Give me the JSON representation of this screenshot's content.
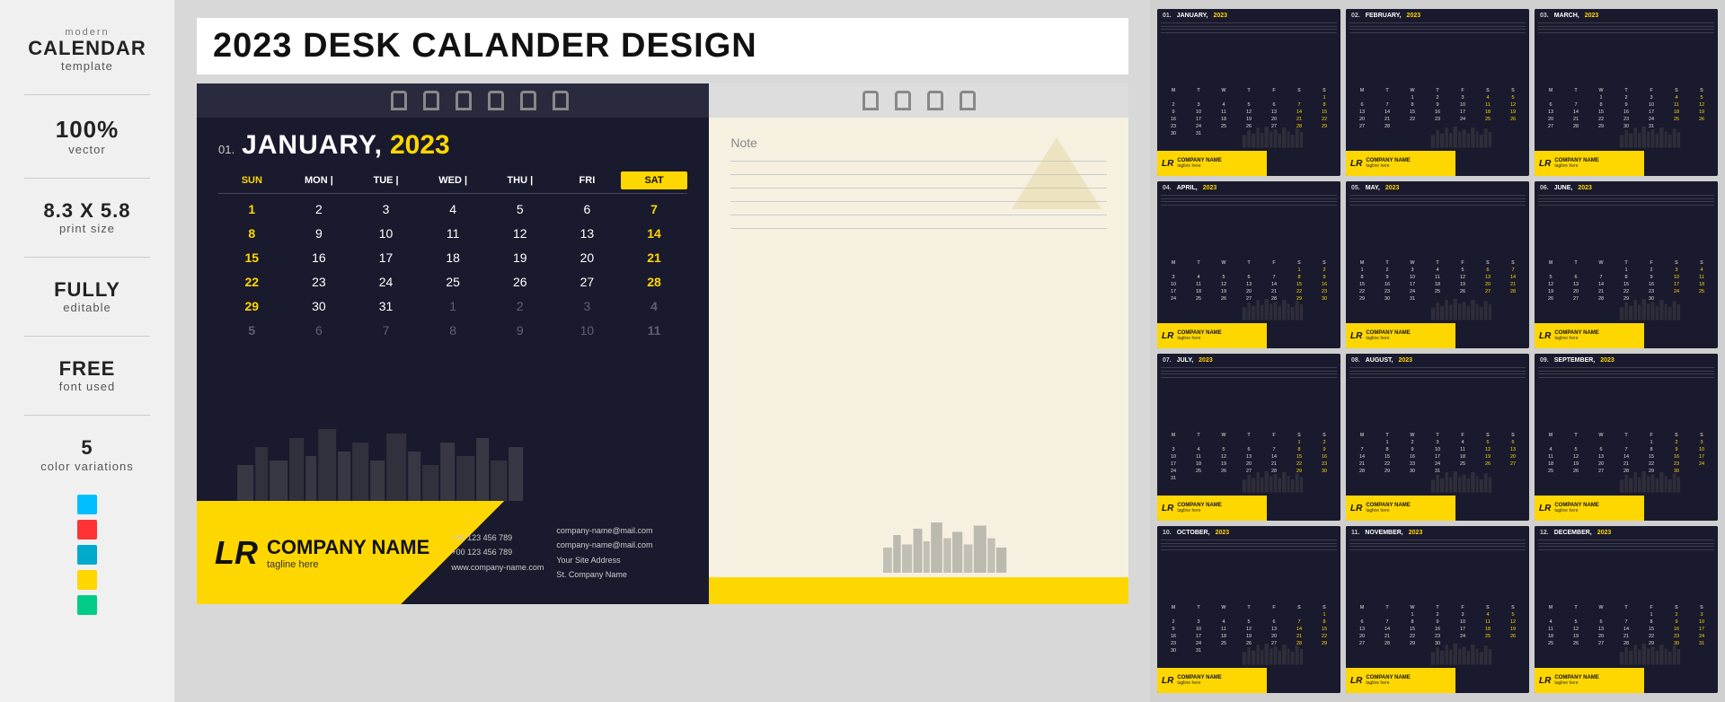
{
  "sidebar": {
    "pre_label": "modern",
    "main_label": "CALENDAR",
    "sub_label": "template",
    "vector_pre": "100%",
    "vector_label": "vector",
    "print_size_pre": "8.3 x 5.8",
    "print_size_label": "print size",
    "editable_pre": "FULLY",
    "editable_label": "editable",
    "font_pre": "FREE",
    "font_label": "font used",
    "colors_pre": "5",
    "colors_label": "color variations",
    "swatches": [
      "#00BFFF",
      "#FF3333",
      "#00AACC",
      "#FFD700",
      "#00CC88"
    ]
  },
  "main": {
    "title": "2023 DESK CALANDER DESIGN",
    "calendar": {
      "month_num": "01.",
      "month_name": "JANUARY,",
      "year": "2023",
      "days_header": [
        "SUN",
        "MON",
        "TUE",
        "WED",
        "THU",
        "FRI",
        "SAT"
      ],
      "days": [
        "1",
        "2",
        "3",
        "4",
        "5",
        "6",
        "7",
        "8",
        "9",
        "10",
        "11",
        "12",
        "13",
        "14",
        "15",
        "16",
        "17",
        "18",
        "19",
        "20",
        "21",
        "22",
        "23",
        "24",
        "25",
        "26",
        "27",
        "28",
        "29",
        "30",
        "31",
        "1",
        "2",
        "3",
        "4",
        "5",
        "6",
        "7",
        "8",
        "9",
        "10",
        "11"
      ],
      "note_label": "Note"
    },
    "company": {
      "logo": "LR",
      "name": "COMPANY NAME",
      "tagline": "tagline here",
      "phone1": "+00 123 456 789",
      "phone2": "+00 123 456 789",
      "website": "www.company-name.com",
      "email1": "company-name@mail.com",
      "email2": "company-name@mail.com",
      "site_label": "Your Site Address",
      "address": "St. Company Name"
    }
  },
  "mini_calendars": [
    {
      "num": "01",
      "month": "JANUARY, 2023",
      "days": [
        "1",
        "2",
        "3",
        "4",
        "5",
        "6",
        "7",
        "8",
        "9",
        "10",
        "11",
        "12",
        "13",
        "14",
        "15",
        "16",
        "17",
        "18",
        "19",
        "20",
        "21",
        "22",
        "23",
        "24",
        "25",
        "26",
        "27",
        "28",
        "29",
        "30",
        "31"
      ]
    },
    {
      "num": "02",
      "month": "FEBRUARY, 2023",
      "days": [
        "",
        "",
        "",
        "1",
        "2",
        "3",
        "4",
        "5",
        "6",
        "7",
        "8",
        "9",
        "10",
        "11",
        "12",
        "13",
        "14",
        "15",
        "16",
        "17",
        "18",
        "19",
        "20",
        "21",
        "22",
        "23",
        "24",
        "25",
        "26",
        "27",
        "28"
      ]
    },
    {
      "num": "03",
      "month": "MARCH, 2023",
      "days": [
        "",
        "",
        "",
        "1",
        "2",
        "3",
        "4",
        "5",
        "6",
        "7",
        "8",
        "9",
        "10",
        "11",
        "12",
        "13",
        "14",
        "15",
        "16",
        "17",
        "18",
        "19",
        "20",
        "21",
        "22",
        "23",
        "24",
        "25",
        "26",
        "27",
        "28",
        "29",
        "30",
        "31"
      ]
    },
    {
      "num": "04",
      "month": "APRIL, 2023",
      "days": [
        "",
        "",
        "",
        "",
        "",
        "",
        "1",
        "2",
        "3",
        "4",
        "5",
        "6",
        "7",
        "8",
        "9",
        "10",
        "11",
        "12",
        "13",
        "14",
        "15",
        "16",
        "17",
        "18",
        "19",
        "20",
        "21",
        "22",
        "23",
        "24",
        "25",
        "26",
        "27",
        "28",
        "29",
        "30"
      ]
    },
    {
      "num": "05",
      "month": "MAY, 2023",
      "days": [
        "1",
        "2",
        "3",
        "4",
        "5",
        "6",
        "7",
        "8",
        "9",
        "10",
        "11",
        "12",
        "13",
        "14",
        "15",
        "16",
        "17",
        "18",
        "19",
        "20",
        "21",
        "22",
        "23",
        "24",
        "25",
        "26",
        "27",
        "28",
        "29",
        "30",
        "31"
      ]
    },
    {
      "num": "06",
      "month": "JUNE, 2023",
      "days": [
        "",
        "",
        "",
        "",
        "1",
        "2",
        "3",
        "4",
        "5",
        "6",
        "7",
        "8",
        "9",
        "10",
        "11",
        "12",
        "13",
        "14",
        "15",
        "16",
        "17",
        "18",
        "19",
        "20",
        "21",
        "22",
        "23",
        "24",
        "25",
        "26",
        "27",
        "28",
        "29",
        "30"
      ]
    },
    {
      "num": "07",
      "month": "JULY, 2023",
      "days": [
        "",
        "",
        "",
        "",
        "",
        "",
        "1",
        "2",
        "3",
        "4",
        "5",
        "6",
        "7",
        "8",
        "9",
        "10",
        "11",
        "12",
        "13",
        "14",
        "15",
        "16",
        "17",
        "18",
        "19",
        "20",
        "21",
        "22",
        "23",
        "24",
        "25",
        "26",
        "27",
        "28",
        "29",
        "30",
        "31"
      ]
    },
    {
      "num": "08",
      "month": "AUGUST, 2023",
      "days": [
        "1",
        "2",
        "3",
        "4",
        "5",
        "6",
        "7",
        "8",
        "9",
        "10",
        "11",
        "12",
        "13",
        "14",
        "15",
        "16",
        "17",
        "18",
        "19",
        "20",
        "21",
        "22",
        "23",
        "24",
        "25",
        "26",
        "27",
        "28",
        "29",
        "30",
        "31"
      ]
    },
    {
      "num": "09",
      "month": "SEPTEMBER, 2023",
      "days": [
        "",
        "",
        "",
        "",
        "",
        "1",
        "2",
        "3",
        "4",
        "5",
        "6",
        "7",
        "8",
        "9",
        "10",
        "11",
        "12",
        "13",
        "14",
        "15",
        "16",
        "17",
        "18",
        "19",
        "20",
        "21",
        "22",
        "23",
        "24",
        "25",
        "26",
        "27",
        "28",
        "29",
        "30"
      ]
    },
    {
      "num": "10",
      "month": "OCTOBER, 2023",
      "days": [
        "1",
        "2",
        "3",
        "4",
        "5",
        "6",
        "7",
        "8",
        "9",
        "10",
        "11",
        "12",
        "13",
        "14",
        "15",
        "16",
        "17",
        "18",
        "19",
        "20",
        "21",
        "22",
        "23",
        "24",
        "25",
        "26",
        "27",
        "28",
        "29",
        "30",
        "31"
      ]
    },
    {
      "num": "11",
      "month": "NOVEMBER, 2023",
      "days": [
        "",
        "",
        "",
        "1",
        "2",
        "3",
        "4",
        "5",
        "6",
        "7",
        "8",
        "9",
        "10",
        "11",
        "12",
        "13",
        "14",
        "15",
        "16",
        "17",
        "18",
        "19",
        "20",
        "21",
        "22",
        "23",
        "24",
        "25",
        "26",
        "27",
        "28",
        "29",
        "30"
      ]
    },
    {
      "num": "12",
      "month": "DECEMBER, 2023",
      "days": [
        "",
        "",
        "",
        "",
        "",
        "1",
        "2",
        "3",
        "4",
        "5",
        "6",
        "7",
        "8",
        "9",
        "10",
        "11",
        "12",
        "13",
        "14",
        "15",
        "16",
        "17",
        "18",
        "19",
        "20",
        "21",
        "22",
        "23",
        "24",
        "25",
        "26",
        "27",
        "28",
        "29",
        "30",
        "31"
      ]
    }
  ]
}
